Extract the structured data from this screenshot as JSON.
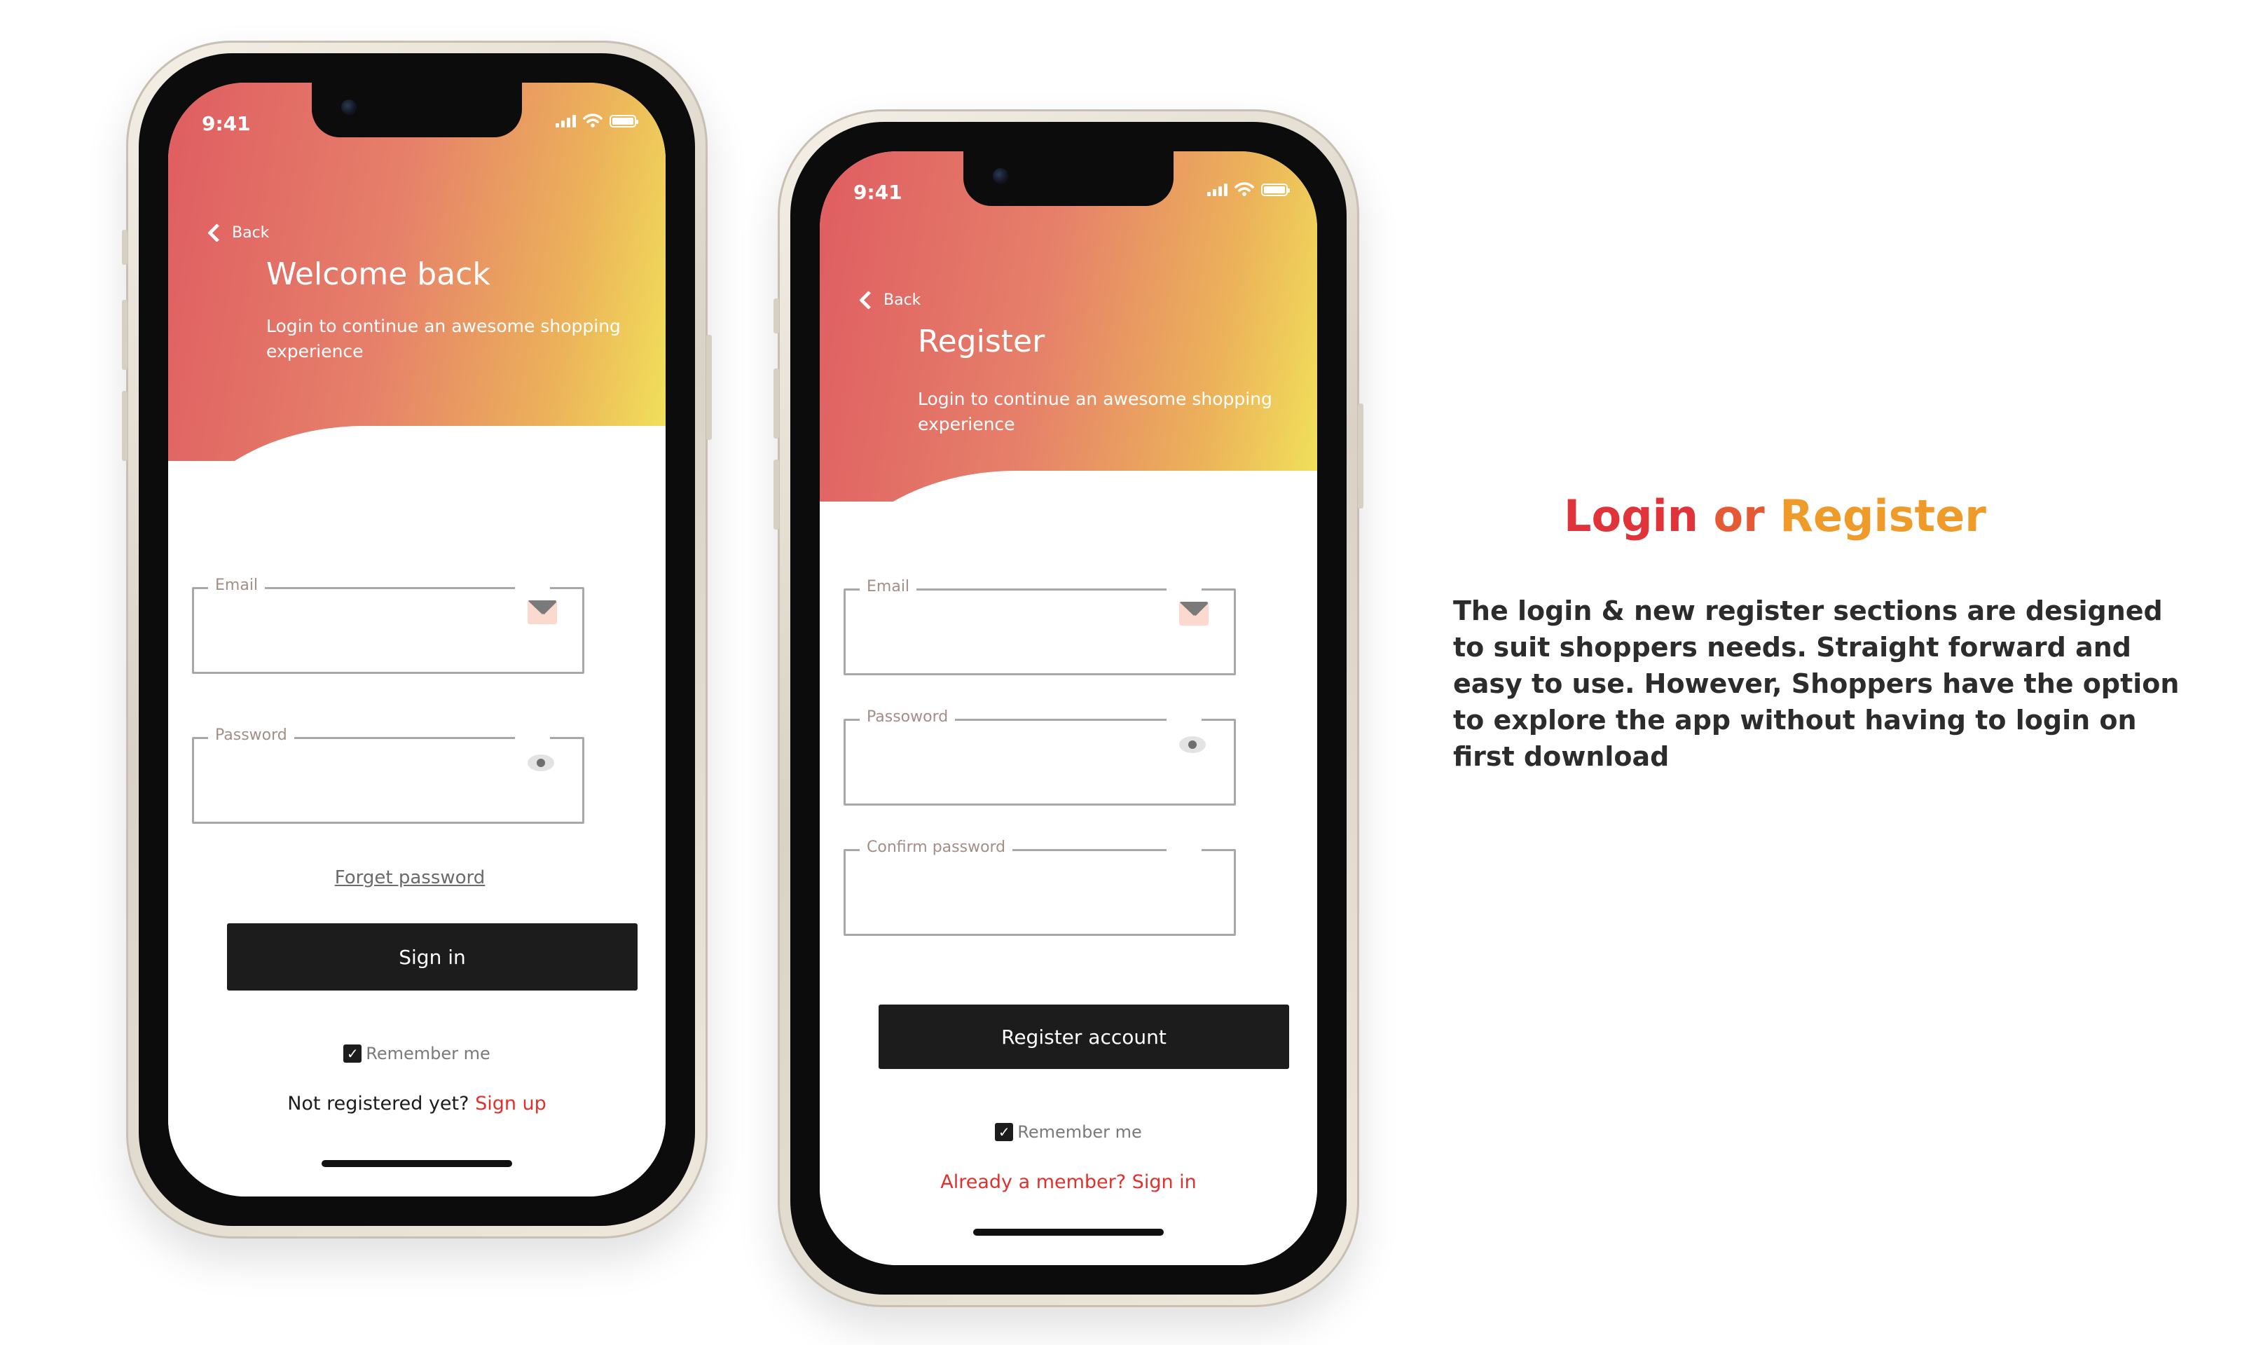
{
  "status_bar": {
    "time": "9:41"
  },
  "login_screen": {
    "back_label": "Back",
    "title": "Welcome back",
    "subtitle": "Login to continue an awesome shopping experience",
    "email_label": "Email",
    "password_label": "Password",
    "forget_password": "Forget password",
    "sign_in_button": "Sign in",
    "remember_me": "Remember me",
    "not_registered": "Not registered yet?",
    "sign_up_link": "Sign up"
  },
  "register_screen": {
    "back_label": "Back",
    "title": "Register",
    "subtitle": "Login to continue an awesome shopping experience",
    "email_label": "Email",
    "password_label": "Passoword",
    "confirm_password_label": "Confirm password",
    "register_button": "Register account",
    "remember_me": "Remember me",
    "already_member": "Already a member? Sign in"
  },
  "description": {
    "heading_part1": "Login",
    "heading_part2": "or",
    "heading_part3": "Register",
    "body": "The login & new register sections are designed to suit shoppers needs. Straight forward and easy to use. However, Shoppers have the option to explore the app without having to login on first download"
  },
  "colors": {
    "gradient_start": "#df5d61",
    "gradient_end": "#f1e25a",
    "accent_red": "#e0322c",
    "button_dark": "#1c1c1c"
  },
  "icons": [
    "chevron-left-icon",
    "signal-icon",
    "wifi-icon",
    "battery-icon",
    "mail-icon",
    "eye-icon",
    "checkbox-checked-icon"
  ]
}
